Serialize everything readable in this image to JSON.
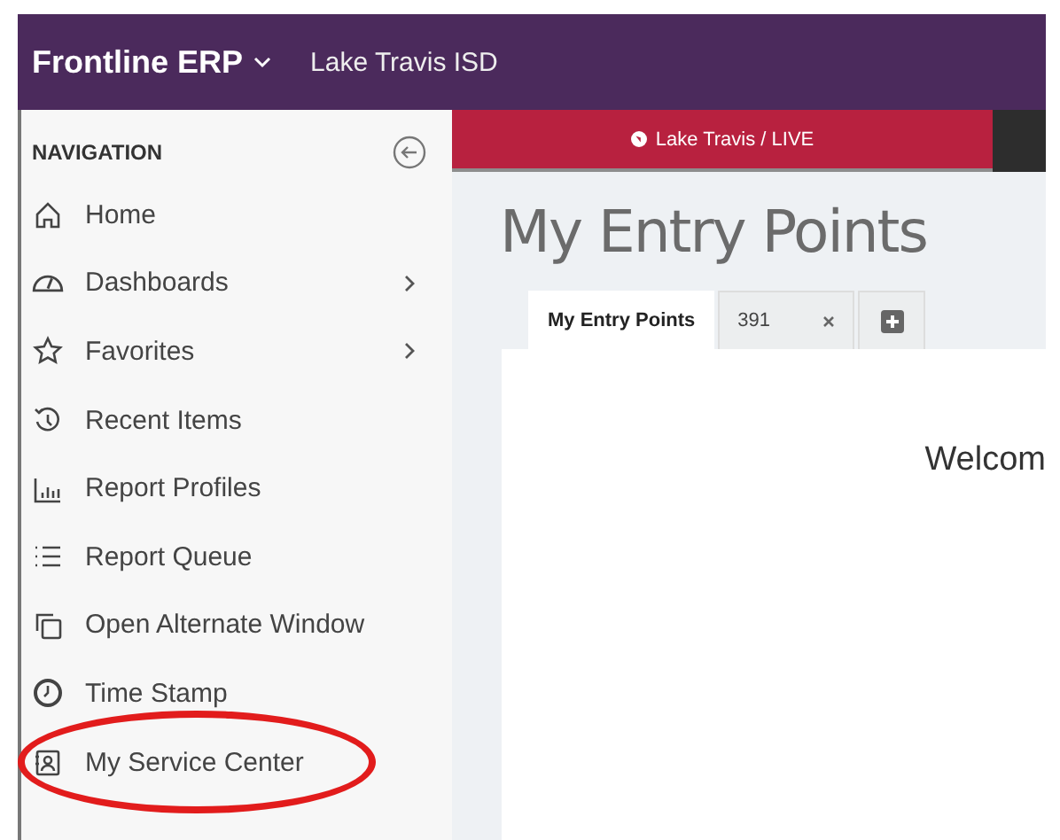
{
  "top_bar": {
    "product": "Frontline ERP",
    "organization": "Lake Travis ISD"
  },
  "sidebar": {
    "heading": "NAVIGATION",
    "items": [
      {
        "label": "Home",
        "submenu": false,
        "circled": false
      },
      {
        "label": "Dashboards",
        "submenu": true,
        "circled": false
      },
      {
        "label": "Favorites",
        "submenu": true,
        "circled": false
      },
      {
        "label": "Recent Items",
        "submenu": false,
        "circled": false
      },
      {
        "label": "Report Profiles",
        "submenu": false,
        "circled": false
      },
      {
        "label": "Report Queue",
        "submenu": false,
        "circled": false
      },
      {
        "label": "Open Alternate Window",
        "submenu": false,
        "circled": false
      },
      {
        "label": "Time Stamp",
        "submenu": false,
        "circled": false
      },
      {
        "label": "My Service Center",
        "submenu": false,
        "circled": true
      }
    ]
  },
  "environment_banner": {
    "label": "Lake Travis / LIVE"
  },
  "page_title": "My Entry Points",
  "tabs": [
    {
      "label": "My Entry Points",
      "selected": true,
      "closable": false
    },
    {
      "label": "391",
      "selected": false,
      "closable": true
    }
  ],
  "content": {
    "heading": "Welcom"
  }
}
